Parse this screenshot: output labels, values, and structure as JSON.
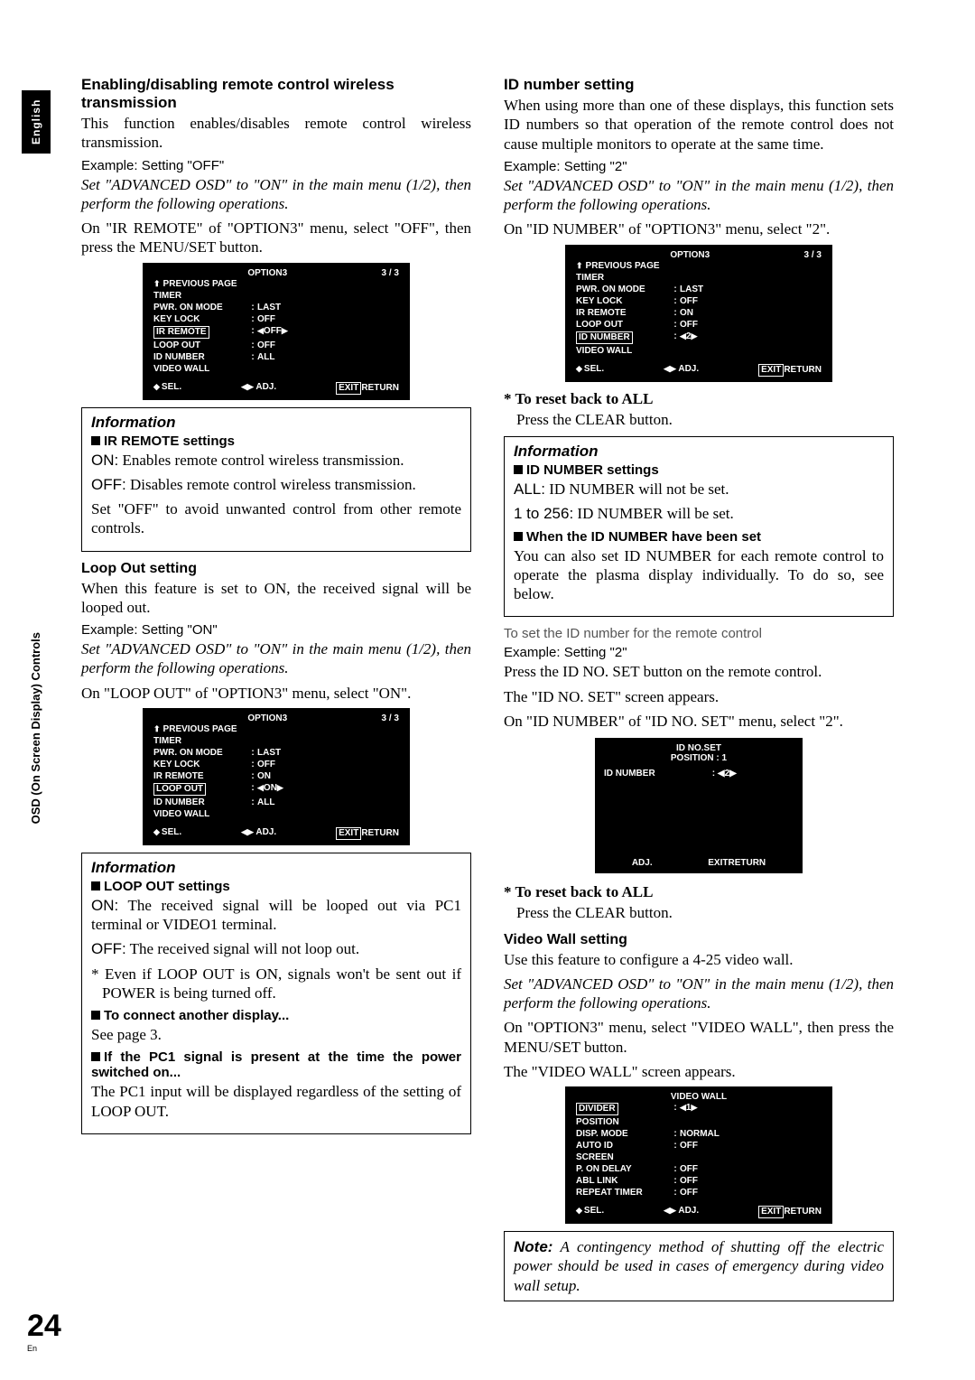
{
  "sideTab": "English",
  "sideLabel": "OSD (On Screen Display) Controls",
  "pageNumber": "24",
  "pageLang": "En",
  "left": {
    "sec1": {
      "title": "Enabling/disabling remote control wireless transmission",
      "body1": "This function enables/disables remote control wireless transmission.",
      "example": "Example: Setting \"OFF\"",
      "italic": "Set \"ADVANCED OSD\" to \"ON\" in the main menu (1/2), then perform the following operations.",
      "body2": "On \"IR REMOTE\" of \"OPTION3\" menu, select \"OFF\", then press the MENU/SET button."
    },
    "info1": {
      "title": "Information",
      "sub": "IR REMOTE settings",
      "on": "ON:",
      "onText": " Enables remote control wireless transmission.",
      "off": "OFF:",
      "offText": " Disables remote control wireless transmission.",
      "body": "Set \"OFF\" to avoid unwanted control from other remote controls."
    },
    "sec2": {
      "title": "Loop Out setting",
      "body1": "When this feature is set to ON, the received signal will be looped out.",
      "example": "Example: Setting \"ON\"",
      "italic": "Set \"ADVANCED OSD\" to \"ON\" in the main menu (1/2), then perform the following operations.",
      "body2": "On \"LOOP OUT\" of \"OPTION3\" menu, select \"ON\"."
    },
    "info2": {
      "title": "Information",
      "sub": "LOOP OUT settings",
      "on": "ON:",
      "onText": " The received signal will be looped out via PC1 terminal or VIDEO1 terminal.",
      "off": "OFF:",
      "offText": " The received signal will not loop out.",
      "note": "* Even if LOOP OUT is ON, signals won't be sent out if POWER is being turned off.",
      "sub2": "To connect another display...",
      "body2": "See page 3.",
      "sub3": "If the PC1 signal is present at the time the power switched on...",
      "body3": "The PC1 input will be displayed regardless of the setting of LOOP OUT."
    }
  },
  "right": {
    "sec1": {
      "title": "ID number setting",
      "body1": "When using more than one of these displays, this function sets ID numbers so that operation of the remote control does not cause multiple monitors to operate at the same time.",
      "example": "Example: Setting \"2\"",
      "italic": "Set \"ADVANCED OSD\" to \"ON\" in the main menu (1/2), then perform the following operations.",
      "body2": "On \"ID NUMBER\" of \"OPTION3\" menu, select \"2\"."
    },
    "reset1": {
      "label": "* To reset back to ALL",
      "body": "Press the CLEAR button."
    },
    "info1": {
      "title": "Information",
      "sub": "ID NUMBER settings",
      "all": "ALL:",
      "allText": " ID NUMBER will not be set.",
      "range": "1 to 256:",
      "rangeText": " ID NUMBER will be set.",
      "sub2": "When the ID NUMBER have been set",
      "body2": "You can also set ID NUMBER for each remote control to operate the plasma display individually. To do so, see below."
    },
    "gray": "To set the ID number for the remote control",
    "sec2": {
      "example": "Example: Setting \"2\"",
      "body1": "Press the ID NO. SET button on the remote control.",
      "body2": "The \"ID NO. SET\" screen appears.",
      "body3": "On \"ID NUMBER\" of \"ID NO. SET\" menu, select \"2\"."
    },
    "reset2": {
      "label": "* To reset back to ALL",
      "body": "Press the CLEAR button."
    },
    "sec3": {
      "title": "Video Wall setting",
      "body1": "Use this feature to configure a 4-25 video wall.",
      "italic": "Set \"ADVANCED OSD\" to \"ON\" in the main menu (1/2), then perform the following operations.",
      "body2": "On \"OPTION3\" menu, select \"VIDEO WALL\", then press the MENU/SET button.",
      "body3": "The \"VIDEO WALL\" screen appears."
    },
    "noteLabel": "Note:",
    "noteBody": " A contingency method of shutting off the electric power should be used in cases of emergency during video wall setup."
  },
  "osd1": {
    "title": "OPTION3",
    "page": "3 / 3",
    "prev": "PREVIOUS PAGE",
    "rows": [
      {
        "label": "TIMER",
        "sep": "",
        "val": ""
      },
      {
        "label": "PWR. ON MODE",
        "sep": ":",
        "val": "LAST"
      },
      {
        "label": "KEY LOCK",
        "sep": ":",
        "val": "OFF"
      },
      {
        "label": "IR REMOTE",
        "sep": ":",
        "val": "OFF",
        "hl": true,
        "arrows": true
      },
      {
        "label": "LOOP OUT",
        "sep": ":",
        "val": "OFF"
      },
      {
        "label": "ID NUMBER",
        "sep": ":",
        "val": "ALL"
      },
      {
        "label": "VIDEO WALL",
        "sep": "",
        "val": ""
      }
    ],
    "sel": "SEL.",
    "adj": "ADJ.",
    "exit": "EXIT",
    "ret": "RETURN"
  },
  "osd2": {
    "title": "OPTION3",
    "page": "3 / 3",
    "prev": "PREVIOUS PAGE",
    "rows": [
      {
        "label": "TIMER",
        "sep": "",
        "val": ""
      },
      {
        "label": "PWR. ON MODE",
        "sep": ":",
        "val": "LAST"
      },
      {
        "label": "KEY LOCK",
        "sep": ":",
        "val": "OFF"
      },
      {
        "label": "IR REMOTE",
        "sep": ":",
        "val": "ON"
      },
      {
        "label": "LOOP OUT",
        "sep": ":",
        "val": "ON",
        "hl": true,
        "arrows": true
      },
      {
        "label": "ID NUMBER",
        "sep": ":",
        "val": "ALL"
      },
      {
        "label": "VIDEO WALL",
        "sep": "",
        "val": ""
      }
    ],
    "sel": "SEL.",
    "adj": "ADJ.",
    "exit": "EXIT",
    "ret": "RETURN"
  },
  "osd3": {
    "title": "OPTION3",
    "page": "3 / 3",
    "prev": "PREVIOUS PAGE",
    "rows": [
      {
        "label": "TIMER",
        "sep": "",
        "val": ""
      },
      {
        "label": "PWR. ON MODE",
        "sep": ":",
        "val": "LAST"
      },
      {
        "label": "KEY LOCK",
        "sep": ":",
        "val": "OFF"
      },
      {
        "label": "IR REMOTE",
        "sep": ":",
        "val": "ON"
      },
      {
        "label": "LOOP OUT",
        "sep": ":",
        "val": "OFF"
      },
      {
        "label": "ID NUMBER",
        "sep": ":",
        "val": "2",
        "hl": true,
        "arrows": true
      },
      {
        "label": "VIDEO WALL",
        "sep": "",
        "val": ""
      }
    ],
    "sel": "SEL.",
    "adj": "ADJ.",
    "exit": "EXIT",
    "ret": "RETURN"
  },
  "osd4": {
    "title": "ID NO.SET",
    "position": "POSITION  :    1",
    "idnum_label": "ID NUMBER",
    "idnum_val": "2",
    "adj": "ADJ.",
    "exit": "EXIT",
    "ret": "RETURN"
  },
  "osd5": {
    "title": "VIDEO WALL",
    "rows": [
      {
        "label": "DIVIDER",
        "sep": ":",
        "val": "1",
        "hl": true,
        "arrows": true
      },
      {
        "label": "POSITION",
        "sep": "",
        "val": ""
      },
      {
        "label": "DISP. MODE",
        "sep": ":",
        "val": "NORMAL"
      },
      {
        "label": "AUTO ID",
        "sep": ":",
        "val": "OFF"
      },
      {
        "label": "SCREEN",
        "sep": "",
        "val": ""
      },
      {
        "label": "P. ON DELAY",
        "sep": ":",
        "val": "OFF"
      },
      {
        "label": "ABL LINK",
        "sep": ":",
        "val": "OFF"
      },
      {
        "label": "REPEAT TIMER",
        "sep": ":",
        "val": "OFF"
      }
    ],
    "sel": "SEL.",
    "adj": "ADJ.",
    "exit": "EXIT",
    "ret": "RETURN"
  }
}
